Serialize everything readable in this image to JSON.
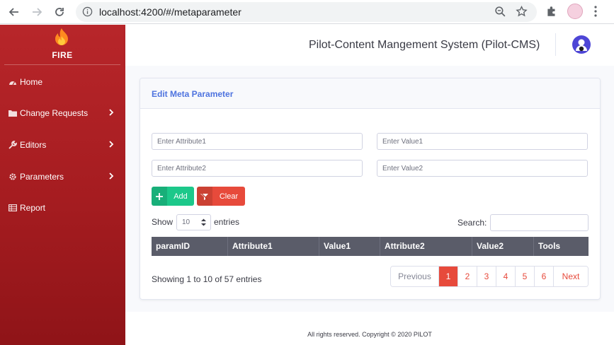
{
  "browser": {
    "url": "localhost:4200/#/metaparameter"
  },
  "sidebar": {
    "brand": "FIRE",
    "items": [
      {
        "label": "Home",
        "icon": "dashboard-icon"
      },
      {
        "label": "Change Requests",
        "icon": "folder-icon"
      },
      {
        "label": "Editors",
        "icon": "wrench-icon"
      },
      {
        "label": "Parameters",
        "icon": "cog-icon"
      },
      {
        "label": "Report",
        "icon": "table-icon"
      }
    ]
  },
  "topbar": {
    "title": "Pilot-Content Mangement System (Pilot-CMS)"
  },
  "card": {
    "title": "Edit Meta Parameter"
  },
  "form": {
    "attribute1_placeholder": "Enter Attribute1",
    "value1_placeholder": "Enter Value1",
    "attribute2_placeholder": "Enter Attribute2",
    "value2_placeholder": "Enter Value2",
    "add_label": "Add",
    "clear_label": "Clear"
  },
  "table": {
    "show_label": "Show",
    "page_size": "10",
    "entries_label": "entries",
    "search_label": "Search:",
    "columns": [
      "paramID",
      "Attribute1",
      "Value1",
      "Attribute2",
      "Value2",
      "Tools"
    ],
    "info": "Showing 1 to 10 of 57 entries",
    "pagination": [
      "Previous",
      "1",
      "2",
      "3",
      "4",
      "5",
      "6",
      "Next"
    ],
    "active_page": "1"
  },
  "footer": {
    "text": "All rights reserved. Copyright © 2020 PILOT"
  },
  "colors": {
    "sidebar": "#a51c20",
    "primary": "#4e73df",
    "success": "#1cc88a",
    "danger": "#e74a3b",
    "table_header": "#5a5c69"
  }
}
